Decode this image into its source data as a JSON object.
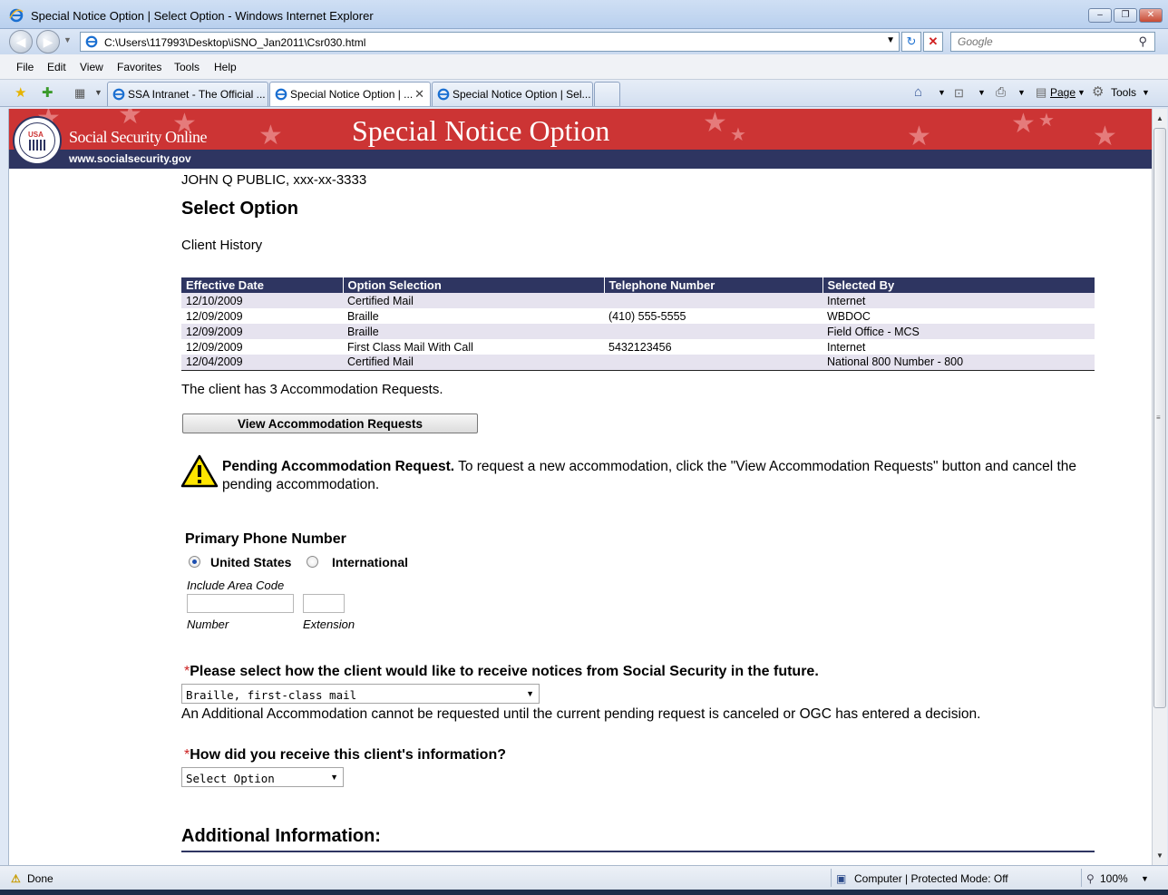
{
  "window": {
    "title": "Special Notice Option | Select Option - Windows Internet Explorer",
    "minimize": "–",
    "maximize": "❐",
    "close": "✕"
  },
  "address_bar": {
    "url": "C:\\Users\\117993\\Desktop\\iSNO_Jan2011\\Csr030.html",
    "search_placeholder": "Google"
  },
  "menu": [
    "File",
    "Edit",
    "View",
    "Favorites",
    "Tools",
    "Help"
  ],
  "tabs": [
    {
      "label": "SSA Intranet - The Official ..."
    },
    {
      "label": "Special Notice Option | ..."
    },
    {
      "label": "Special Notice Option | Sel..."
    }
  ],
  "toolbar": {
    "page_label": "Page",
    "tools_label": "Tools"
  },
  "site": {
    "name": "Social Security Online",
    "url": "www.socialsecurity.gov",
    "page_title": "Special Notice Option",
    "seal_text": "USA"
  },
  "content": {
    "client_name": "JOHN Q PUBLIC, xxx-xx-3333",
    "heading": "Select Option",
    "history_label": "Client History",
    "history_columns": [
      "Effective Date",
      "Option Selection",
      "Telephone Number",
      "Selected By"
    ],
    "history_rows": [
      [
        "12/10/2009",
        "Certified Mail",
        "",
        "Internet"
      ],
      [
        "12/09/2009",
        "Braille",
        "(410) 555-5555",
        "WBDOC"
      ],
      [
        "12/09/2009",
        "Braille",
        "",
        "Field Office - MCS"
      ],
      [
        "12/09/2009",
        "First Class Mail With Call",
        "5432123456",
        "Internet"
      ],
      [
        "12/04/2009",
        "Certified Mail",
        "",
        "National 800 Number - 800"
      ]
    ],
    "accommodation_text": "The client has 3 Accommodation Requests.",
    "view_button": "View Accommodation Requests",
    "pending_bold": "Pending Accommodation Request.",
    "pending_text": " To request a new accommodation, click the \"View Accommodation Requests\" button and cancel the pending accommodation.",
    "phone_heading": "Primary Phone Number",
    "radio_us": "United States",
    "radio_intl": "International",
    "selected_country": "United States",
    "area_code_hint": "Include Area Code",
    "number_label": "Number",
    "extension_label": "Extension",
    "number_value": "",
    "extension_value": "",
    "required_mark": "*",
    "q_notices": "Please select how the client would like to receive notices from Social Security in the future.",
    "notice_selected": "Braille, first-class mail",
    "additional_note": "An Additional Accommodation cannot be requested until the current pending request is canceled or OGC has entered a decision.",
    "q_received": "How did you receive this client's information?",
    "received_selected": "Select Option",
    "additional_heading": "Additional Information:"
  },
  "status": {
    "left": "Done",
    "zone": "Computer | Protected Mode: Off",
    "zoom": "100%"
  },
  "colors": {
    "header_red": "#cc3434",
    "header_navy": "#2e3561",
    "required_red": "#cc2222"
  }
}
